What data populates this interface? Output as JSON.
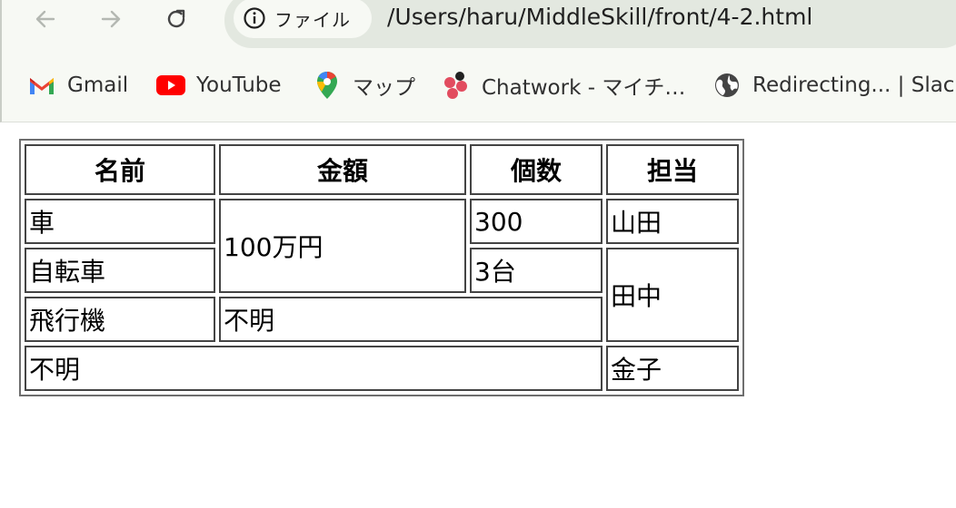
{
  "browser": {
    "nav": {
      "back_icon": "arrow-left-icon",
      "forward_icon": "arrow-right-icon",
      "reload_icon": "reload-icon"
    },
    "address": {
      "scheme_label": "ファイル",
      "url": "/Users/haru/MiddleSkill/front/4-2.html"
    },
    "bookmarks": [
      {
        "label": "Gmail",
        "icon": "gmail-icon"
      },
      {
        "label": "YouTube",
        "icon": "youtube-icon"
      },
      {
        "label": "マップ",
        "icon": "maps-pin-icon"
      },
      {
        "label": "Chatwork - マイチ…",
        "icon": "chatwork-icon"
      },
      {
        "label": "Redirecting... | Slack",
        "icon": "globe-icon"
      }
    ]
  },
  "table": {
    "headers": [
      "名前",
      "金額",
      "個数",
      "担当"
    ],
    "rows": {
      "r1": {
        "name": "車",
        "amount": "100万円",
        "count": "300",
        "person": "山田"
      },
      "r2": {
        "name": "自転車",
        "count": "3台",
        "person": "田中"
      },
      "r3": {
        "name": "飛行機",
        "amount": "不明"
      },
      "r4": {
        "name": "不明",
        "person": "金子"
      }
    }
  },
  "colors": {
    "chrome_bg": "#f7f9f4",
    "omnibox_bg": "#e3e8e0",
    "youtube_red": "#ff0000",
    "chatwork_red": "#e24c5f"
  }
}
